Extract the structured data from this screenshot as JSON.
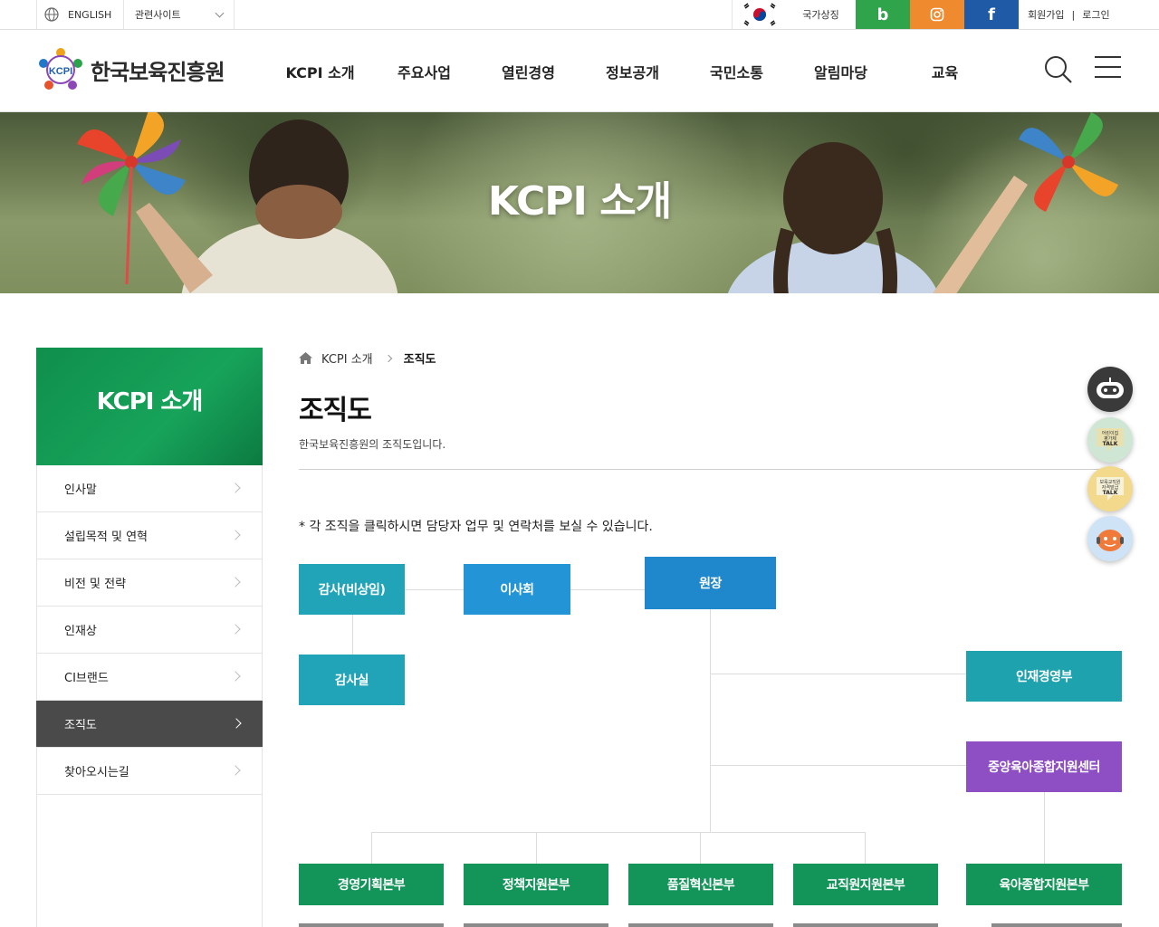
{
  "topbar": {
    "language": "ENGLISH",
    "related_sites": "관련사이트",
    "national_symbol": "국가상징",
    "blog_icon_label": "b",
    "facebook_icon_label": "f",
    "signup": "회원가입",
    "separator": "|",
    "login": "로그인"
  },
  "header": {
    "logo_mark_text": "KCPI",
    "logo_text": "한국보육진흥원",
    "nav": [
      "KCPI 소개",
      "주요사업",
      "열린경영",
      "정보공개",
      "국민소통",
      "알림마당",
      "교육"
    ]
  },
  "hero": {
    "title": "KCPI 소개"
  },
  "sidebar": {
    "title": "KCPI 소개",
    "items": [
      {
        "label": "인사말",
        "active": false
      },
      {
        "label": "설립목적 및 연혁",
        "active": false
      },
      {
        "label": "비전 및 전략",
        "active": false
      },
      {
        "label": "인재상",
        "active": false
      },
      {
        "label": "CI브랜드",
        "active": false
      },
      {
        "label": "조직도",
        "active": true
      },
      {
        "label": "찾아오시는길",
        "active": false
      }
    ]
  },
  "breadcrumb": {
    "section": "KCPI 소개",
    "current": "조직도"
  },
  "page": {
    "title": "조직도",
    "description": "한국보육진흥원의 조직도입니다.",
    "notice": "* 각 조직을 클릭하시면 담당자 업무 및 연락처를 보실 수 있습니다."
  },
  "org": {
    "auditor": "감사(비상임)",
    "board": "이사회",
    "president": "원장",
    "audit_office": "감사실",
    "hr": "인재경영부",
    "central_center": "중앙육아종합지원센터",
    "divisions": [
      "경영기획본부",
      "정책지원본부",
      "품질혁신본부",
      "교직원지원본부",
      "육아종합지원본부"
    ]
  },
  "floating": {
    "talk1": [
      "어린이집",
      "평가제",
      "TALK"
    ],
    "talk2": [
      "보육교직원",
      "자격발급",
      "TALK"
    ]
  },
  "colors": {
    "green": "#13955a",
    "teal": "#22a4b8",
    "blue": "#2395d7",
    "president_blue": "#1f87cc",
    "purple": "#8d4fc3",
    "hr_teal": "#1ea2ad"
  }
}
